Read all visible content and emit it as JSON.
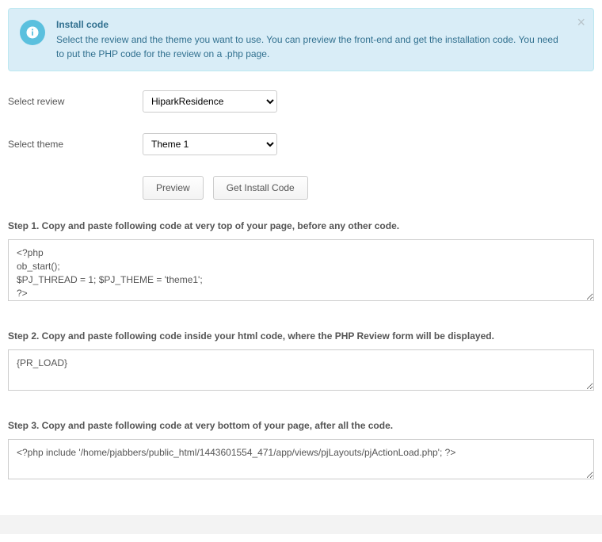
{
  "alert": {
    "title": "Install code",
    "text": "Select the review and the theme you want to use. You can preview the front-end and get the installation code. You need to put the PHP code for the review on a .php page."
  },
  "form": {
    "review_label": "Select review",
    "review_value": "HiparkResidence",
    "theme_label": "Select theme",
    "theme_value": "Theme 1"
  },
  "buttons": {
    "preview": "Preview",
    "get_code": "Get Install Code"
  },
  "steps": {
    "step1_label": "Step 1. Copy and paste following code at very top of your page, before any other code.",
    "step1_code": "<?php\nob_start();\n$PJ_THREAD = 1; $PJ_THEME = 'theme1';\n?>",
    "step2_label": "Step 2. Copy and paste following code inside your html code, where the PHP Review form will be displayed.",
    "step2_code": "{PR_LOAD}",
    "step3_label": "Step 3. Copy and paste following code at very bottom of your page, after all the code.",
    "step3_code": "<?php include '/home/pjabbers/public_html/1443601554_471/app/views/pjLayouts/pjActionLoad.php'; ?>"
  }
}
